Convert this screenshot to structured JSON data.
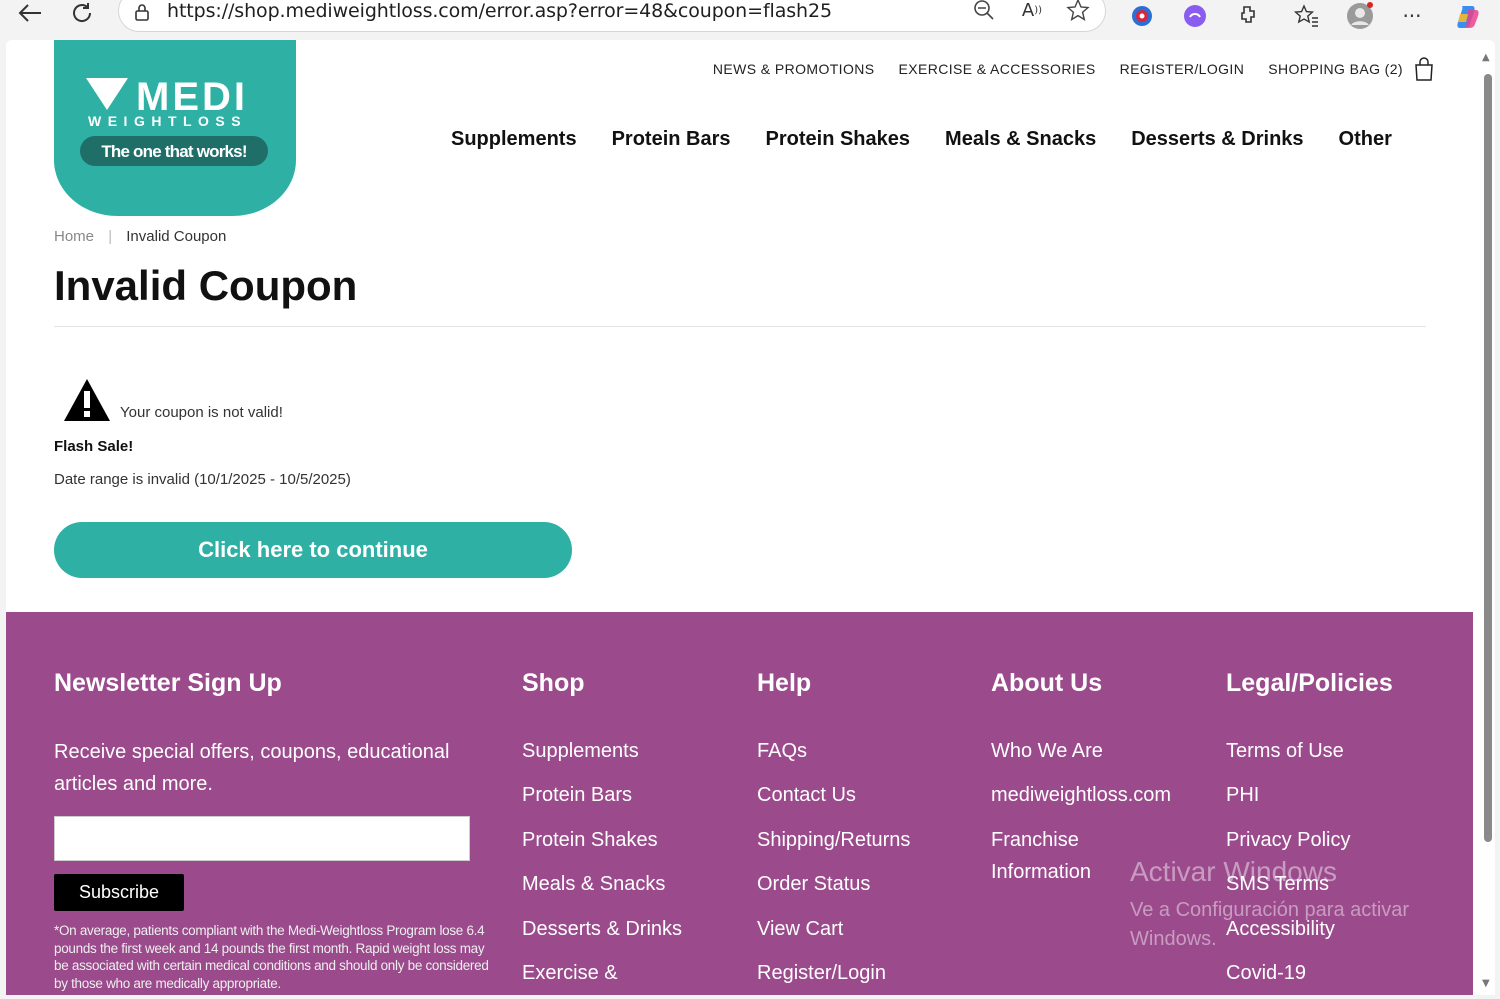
{
  "browser": {
    "url": "https://shop.mediweightloss.com/error.asp?error=48&coupon=flash25",
    "icons": [
      "back-icon",
      "refresh-icon",
      "lock-icon",
      "zoom-out-icon",
      "read-aloud-icon",
      "favorite-star-icon",
      "extension-icon",
      "favorites-icon",
      "profile-icon",
      "more-icon",
      "copilot-icon"
    ]
  },
  "logo": {
    "line1": "MEDI",
    "line2": "WEIGHTLOSS",
    "tagline": "The one that works!"
  },
  "util_nav": [
    "NEWS & PROMOTIONS",
    "EXERCISE & ACCESSORIES",
    "REGISTER/LOGIN",
    "SHOPPING BAG (2)"
  ],
  "main_nav": [
    "Supplements",
    "Protein Bars",
    "Protein Shakes",
    "Meals & Snacks",
    "Desserts & Drinks",
    "Other"
  ],
  "breadcrumb": {
    "home": "Home",
    "separator": "|",
    "current": "Invalid Coupon"
  },
  "page": {
    "title": "Invalid Coupon",
    "warning": "Your coupon is not valid!",
    "sale_name": "Flash Sale!",
    "date_message": "Date range is invalid (10/1/2025 - 10/5/2025)",
    "continue_label": "Click here to continue"
  },
  "footer": {
    "newsletter": {
      "heading": "Newsletter Sign Up",
      "description": "Receive special offers, coupons, educational articles and more.",
      "subscribe_label": "Subscribe",
      "disclaimer": "*On average, patients compliant with the Medi-Weightloss Program lose 6.4 pounds the first week and 14 pounds the first month. Rapid weight loss may be associated with certain medical conditions and should only be considered by those who are medically appropriate."
    },
    "shop": {
      "heading": "Shop",
      "links": [
        "Supplements",
        "Protein Bars",
        "Protein Shakes",
        "Meals & Snacks",
        "Desserts & Drinks",
        "Exercise &"
      ]
    },
    "help": {
      "heading": "Help",
      "links": [
        "FAQs",
        "Contact Us",
        "Shipping/Returns",
        "Order Status",
        "View Cart",
        "Register/Login"
      ]
    },
    "about": {
      "heading": "About Us",
      "links": [
        "Who We Are",
        "mediweightloss.com",
        "Franchise",
        "Information"
      ]
    },
    "legal": {
      "heading": "Legal/Policies",
      "links": [
        "Terms of Use",
        "PHI",
        "Privacy Policy",
        "SMS Terms",
        "Accessibility",
        "Covid-19"
      ]
    },
    "watermark": {
      "line1": "Activar Windows",
      "line2": "Ve a Configuración para activar",
      "line3": "Windows."
    }
  },
  "colors": {
    "teal": "#2fb0a4",
    "footer_purple": "#9b4a8c"
  }
}
